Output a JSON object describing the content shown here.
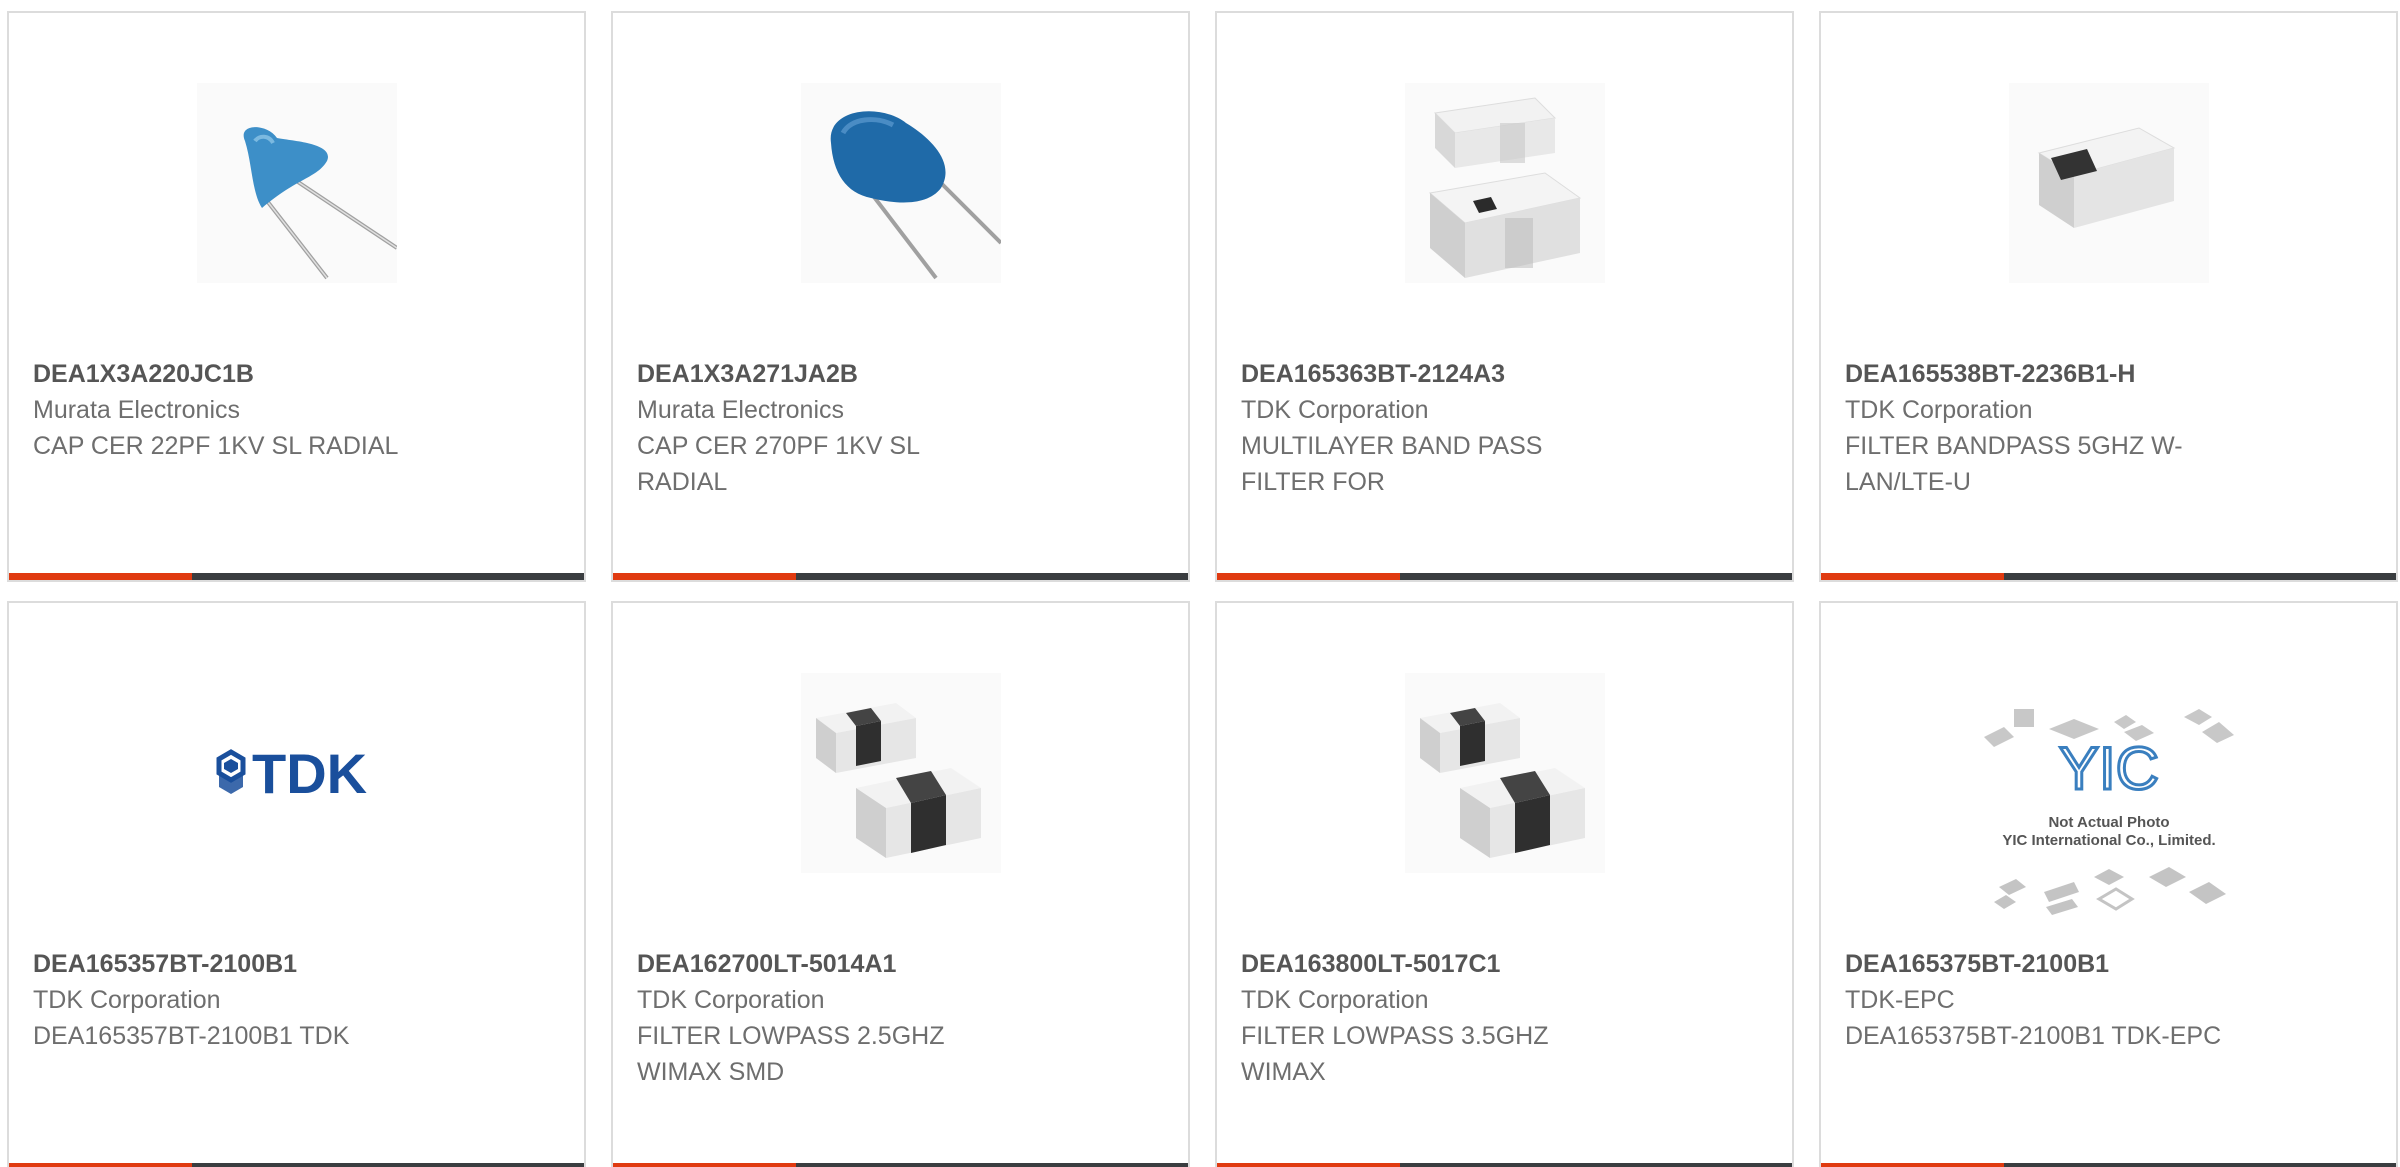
{
  "products": [
    {
      "part_number": "DEA1X3A220JC1B",
      "manufacturer": "Murata Electronics",
      "description": "CAP CER 22PF 1KV SL RADIAL",
      "image": "blue-radial-capacitor-light"
    },
    {
      "part_number": "DEA1X3A271JA2B",
      "manufacturer": "Murata Electronics",
      "description": "CAP CER 270PF 1KV SL RADIAL",
      "image": "blue-radial-capacitor-dark"
    },
    {
      "part_number": "DEA165363BT-2124A3",
      "manufacturer": "TDK Corporation",
      "description": "MULTILAYER BAND PASS FILTER FOR",
      "image": "smd-filter-pair"
    },
    {
      "part_number": "DEA165538BT-2236B1-H",
      "manufacturer": "TDK Corporation",
      "description": "FILTER BANDPASS 5GHZ W-LAN/LTE-U",
      "image": "smd-filter-single"
    },
    {
      "part_number": "DEA165357BT-2100B1",
      "manufacturer": "TDK Corporation",
      "description": "DEA165357BT-2100B1 TDK",
      "image": "tdk-logo"
    },
    {
      "part_number": "DEA162700LT-5014A1",
      "manufacturer": "TDK Corporation",
      "description": "FILTER LOWPASS 2.5GHZ WIMAX SMD",
      "image": "smd-chip-pair"
    },
    {
      "part_number": "DEA163800LT-5017C1",
      "manufacturer": "TDK Corporation",
      "description": "FILTER LOWPASS 3.5GHZ WIMAX",
      "image": "smd-chip-pair"
    },
    {
      "part_number": "DEA165375BT-2100B1",
      "manufacturer": "TDK-EPC",
      "description": "DEA165375BT-2100B1 TDK-EPC",
      "image": "not-actual-photo"
    }
  ],
  "logo_text": "TDK",
  "placeholder_photo": {
    "line1": "Not Actual Photo",
    "line2": "YIC International Co., Limited.",
    "logo": "YIC"
  },
  "colors": {
    "accent": "#e03a10",
    "bar": "#3a3d40",
    "capacitor_light": "#3d8fc8",
    "capacitor_dark": "#1f6aa8",
    "tdk_blue": "#1a4f9c"
  }
}
